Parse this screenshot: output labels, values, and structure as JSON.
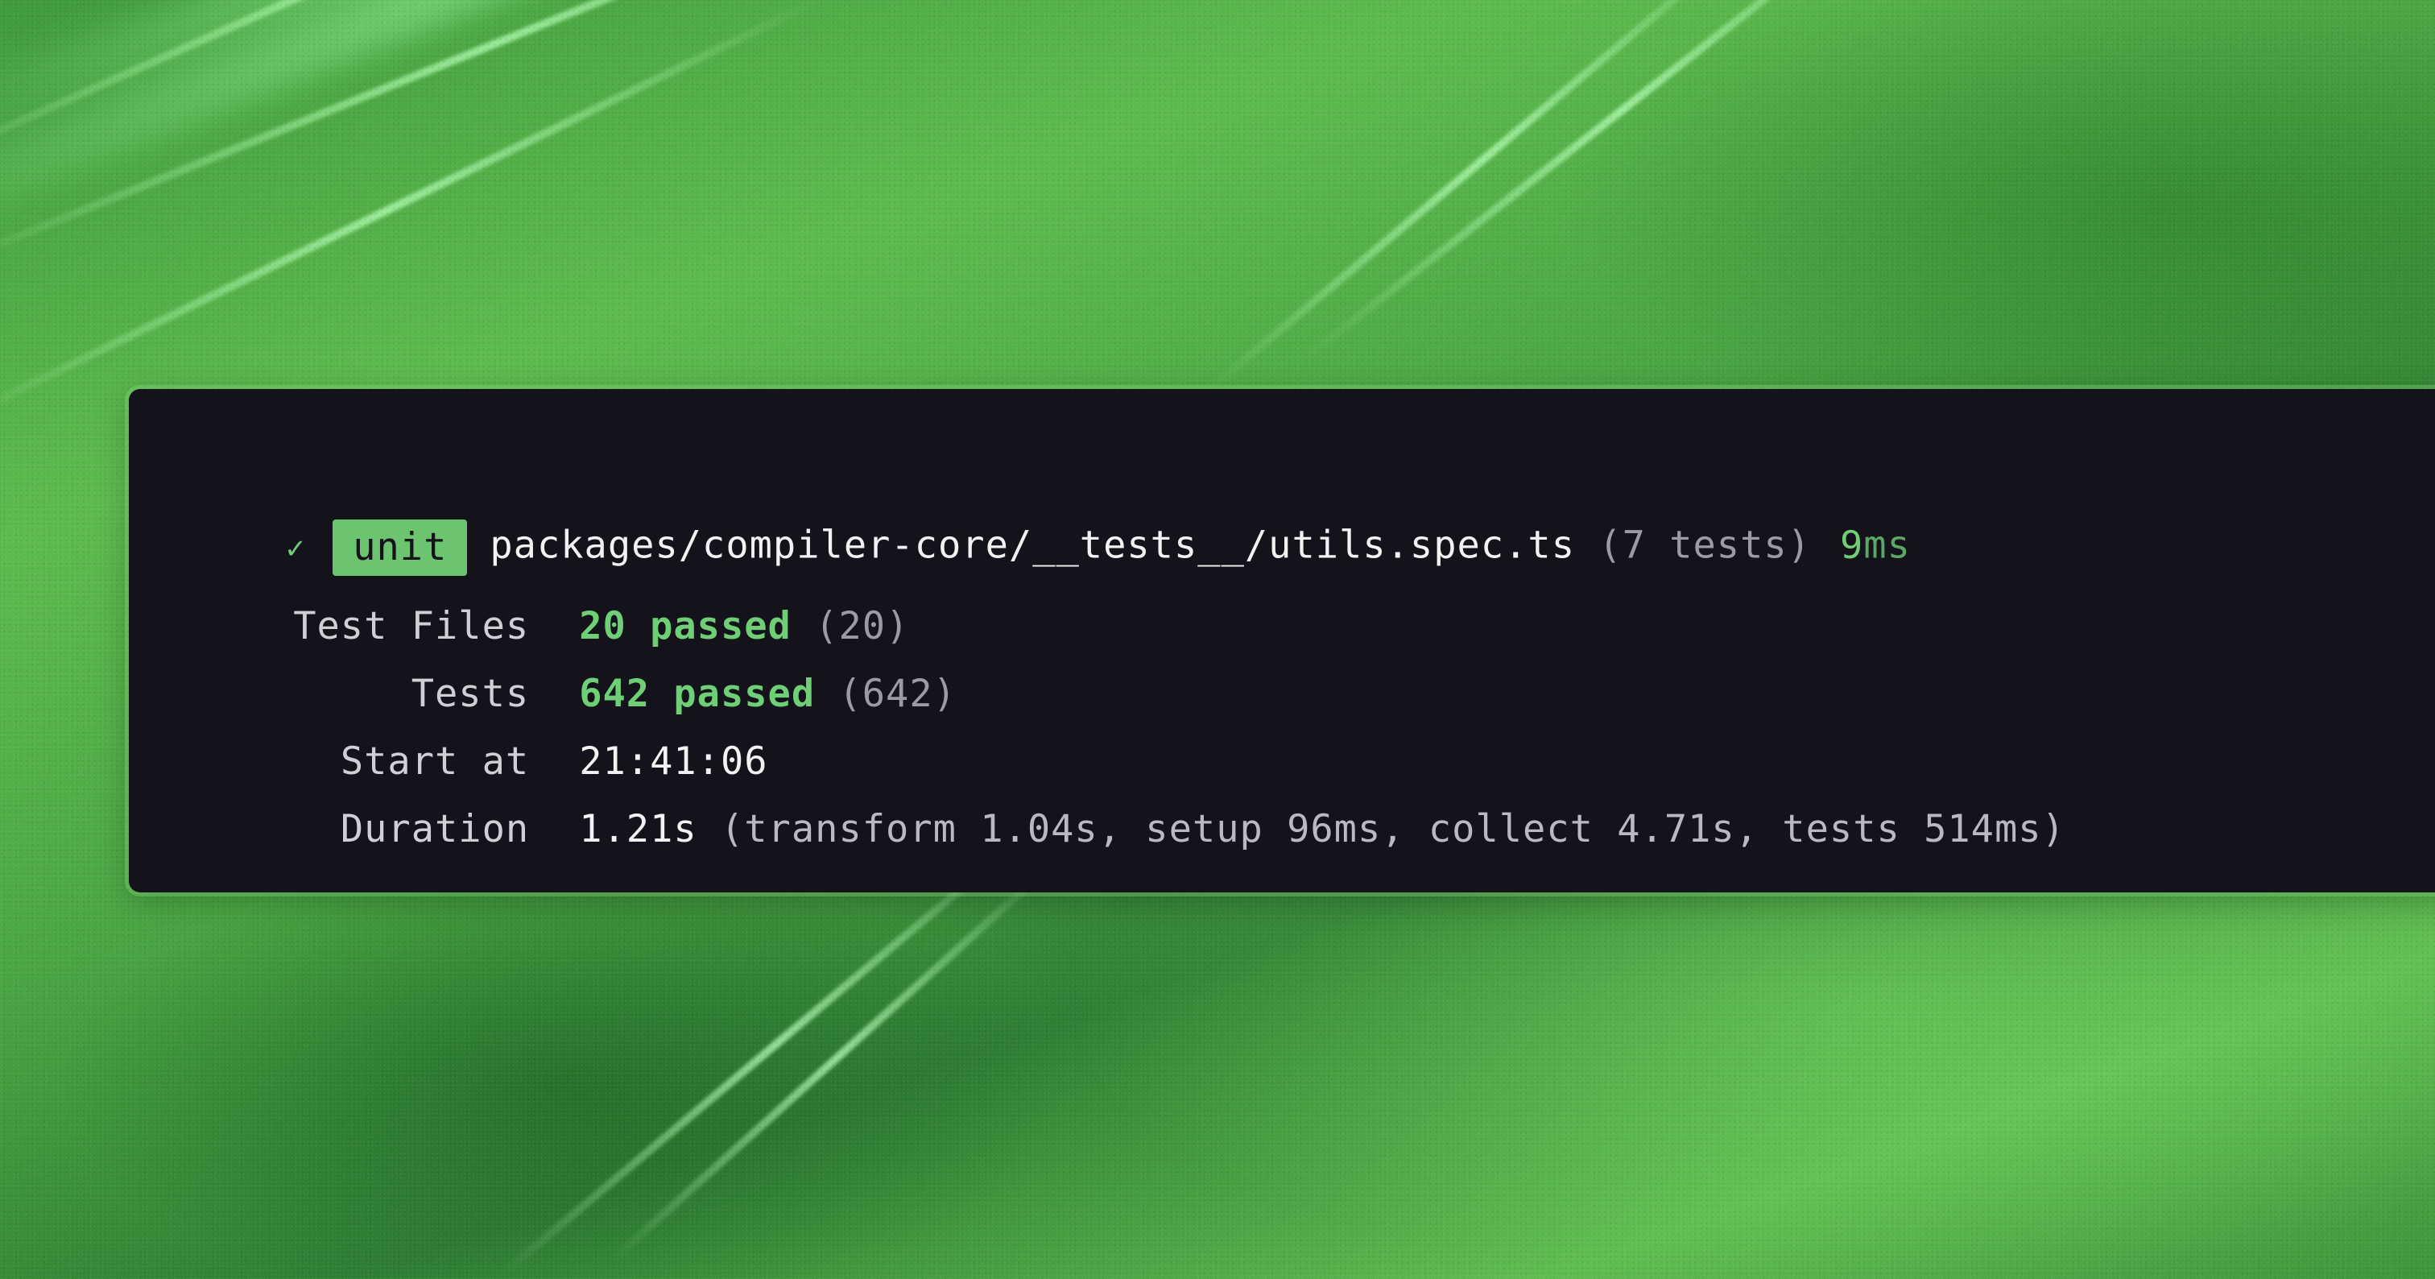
{
  "colors": {
    "terminal_bg": "#14131b",
    "accent_green": "#6fcf76",
    "badge_bg": "#6cc470",
    "dim_text": "#9b9ba2"
  },
  "file_result": {
    "status_icon": "check-icon",
    "status_glyph": "✓",
    "project_badge": "unit",
    "file_path": "packages/compiler-core/__tests__/utils.spec.ts",
    "test_count": "(7 tests)",
    "time_value": "9",
    "time_unit": "ms"
  },
  "summary": {
    "test_files": {
      "label": "Test Files",
      "passed": "20 passed",
      "total": "(20)"
    },
    "tests": {
      "label": "Tests",
      "passed": "642 passed",
      "total": "(642)"
    },
    "start_at": {
      "label": "Start at",
      "value": "21:41:06"
    },
    "duration": {
      "label": "Duration",
      "value": "1.21s",
      "detail": "(transform 1.04s, setup 96ms, collect 4.71s, tests 514ms)"
    }
  }
}
